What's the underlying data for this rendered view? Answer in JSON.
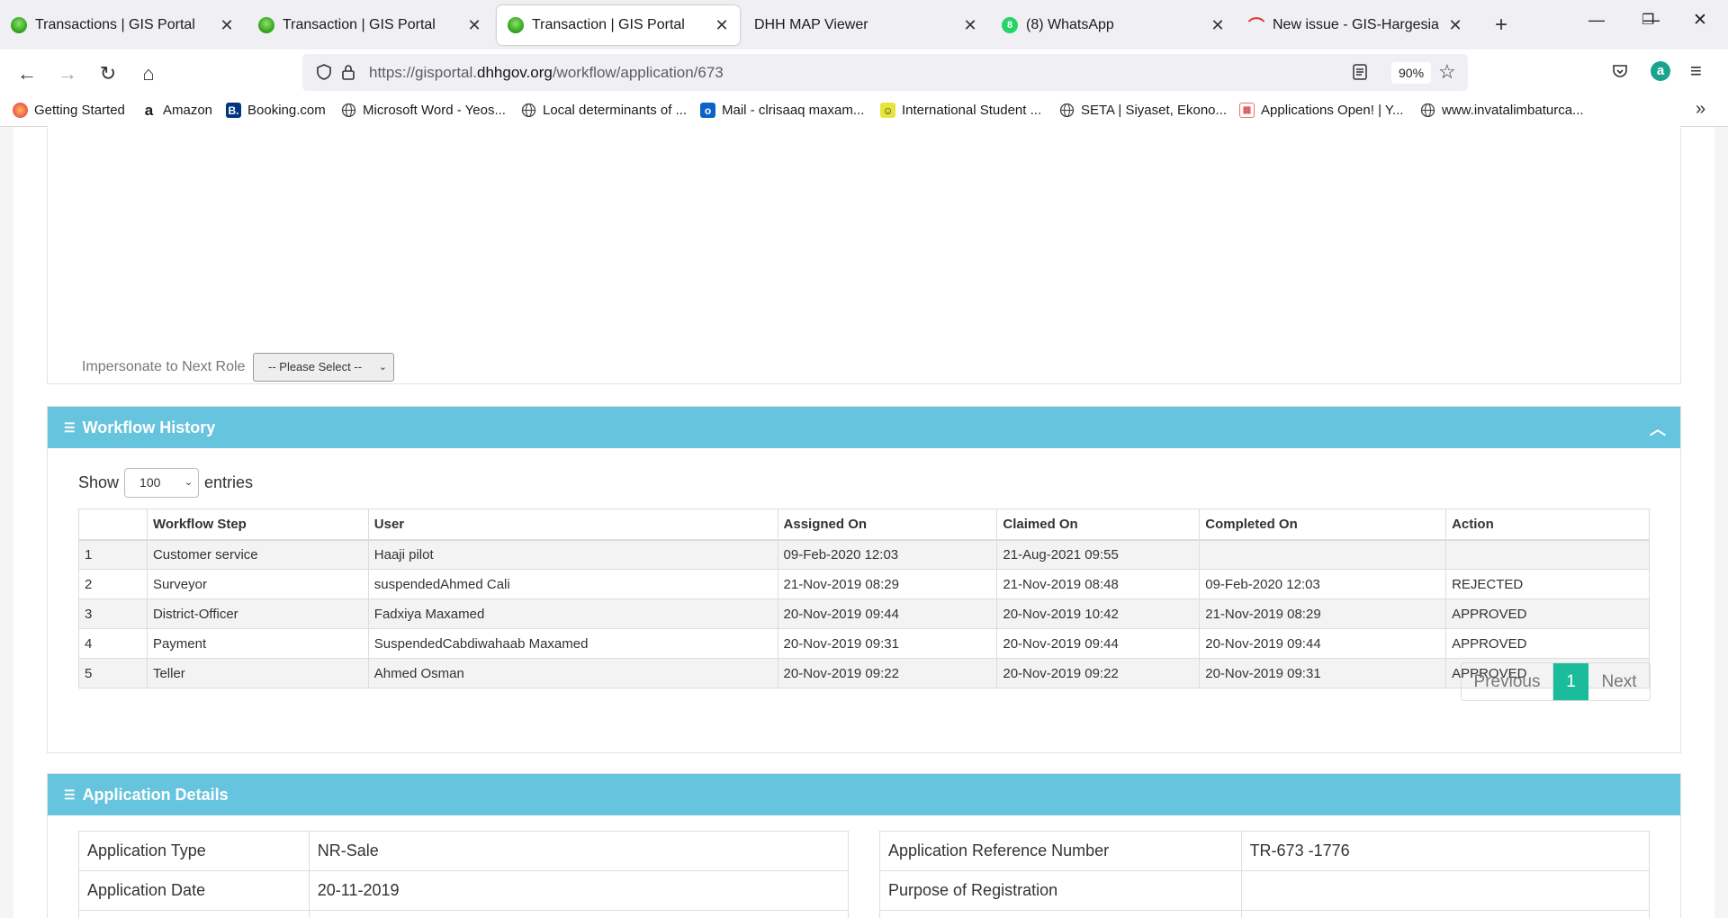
{
  "browser": {
    "tabs": [
      {
        "title": "Transactions | GIS Portal",
        "active": false
      },
      {
        "title": "Transaction | GIS Portal",
        "active": false
      },
      {
        "title": "Transaction | GIS Portal",
        "active": true
      },
      {
        "title": "DHH MAP Viewer",
        "active": false
      },
      {
        "title": "(8) WhatsApp",
        "active": false
      },
      {
        "title": "New issue - GIS-Hargesia - Tea",
        "active": false
      }
    ],
    "url_prefix": "https://gisportal.",
    "url_domain": "dhhgov.org",
    "url_path": "/workflow/application/673",
    "zoom": "90%",
    "bookmarks": [
      "Getting Started",
      "Amazon",
      "Booking.com",
      "Microsoft Word - Yeos...",
      "Local determinants of ...",
      "Mail - clrisaaq maxam...",
      "International Student ...",
      "SETA | Siyaset, Ekono...",
      "Applications Open! | Y...",
      "www.invatalimbaturca..."
    ]
  },
  "impersonate": {
    "label": "Impersonate to Next Role",
    "selected": "-- Please Select --"
  },
  "workflow": {
    "title": "Workflow History",
    "show_label": "Show",
    "page_size": "100",
    "entries_label": "entries",
    "columns": [
      "",
      "Workflow Step",
      "User",
      "Assigned On",
      "Claimed On",
      "Completed On",
      "Action"
    ],
    "rows": [
      [
        "1",
        "Customer service",
        "Haaji pilot",
        "09-Feb-2020 12:03",
        "21-Aug-2021 09:55",
        "",
        ""
      ],
      [
        "2",
        "Surveyor",
        "suspendedAhmed Cali",
        "21-Nov-2019 08:29",
        "21-Nov-2019 08:48",
        "09-Feb-2020 12:03",
        "REJECTED"
      ],
      [
        "3",
        "District-Officer",
        "Fadxiya Maxamed",
        "20-Nov-2019 09:44",
        "20-Nov-2019 10:42",
        "21-Nov-2019 08:29",
        "APPROVED"
      ],
      [
        "4",
        "Payment",
        "SuspendedCabdiwahaab Maxamed",
        "20-Nov-2019 09:31",
        "20-Nov-2019 09:44",
        "20-Nov-2019 09:44",
        "APPROVED"
      ],
      [
        "5",
        "Teller",
        "Ahmed Osman",
        "20-Nov-2019 09:22",
        "20-Nov-2019 09:22",
        "20-Nov-2019 09:31",
        "APPROVED"
      ]
    ],
    "pager": {
      "previous": "Previous",
      "current": "1",
      "next": "Next"
    }
  },
  "application": {
    "title": "Application Details",
    "left": [
      {
        "label": "Application Type",
        "value": "NR-Sale"
      },
      {
        "label": "Application Date",
        "value": "20-11-2019"
      }
    ],
    "right": [
      {
        "label": "Application Reference Number",
        "value": "TR-673 -1776"
      },
      {
        "label": "Purpose of Registration",
        "value": ""
      }
    ]
  },
  "colors": {
    "panel_header": "#66c4df",
    "rejected": "#e74c3c",
    "approved": "#1abc6c",
    "pager_active": "#1abc9c"
  }
}
